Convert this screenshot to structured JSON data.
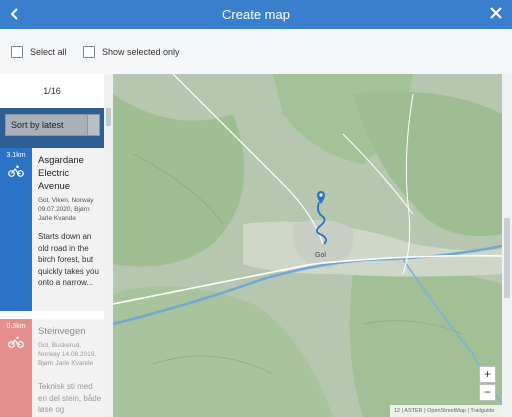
{
  "header": {
    "title": "Create map"
  },
  "toolbar": {
    "select_all_label": "Select all",
    "show_selected_label": "Show selected only"
  },
  "sidebar": {
    "pager": "1/16",
    "sort_label": "Sort by latest",
    "routes": [
      {
        "distance": "3.1km",
        "title": "Asgardane Electric Avenue",
        "meta": "Gol, Viken, Norway 09.07.2020, Bjørn Jarle Kvande",
        "description": "Starts down an old road in the birch forest, but quickly takes you onto a narrow...",
        "accent": "#2b73c7",
        "icon": "cyclist-icon"
      },
      {
        "distance": "0.3km",
        "title": "Steinvegen",
        "meta": "Gol, Buskerud, Norway 14.08.2019, Bjørn Jarle Kvande",
        "description": "Teknisk sti med en del stein, både løse og",
        "accent": "#e58f8f",
        "icon": "cyclist-icon"
      }
    ]
  },
  "map": {
    "place_label": "Gol",
    "zoom_in": "+",
    "zoom_out": "−",
    "attribution": "12 | ASTER | OpenStreetMap | Trailguide"
  },
  "colors": {
    "header": "#3a7fcd",
    "sort_bar": "#2d5e94",
    "route_line": "#2b73c7"
  }
}
